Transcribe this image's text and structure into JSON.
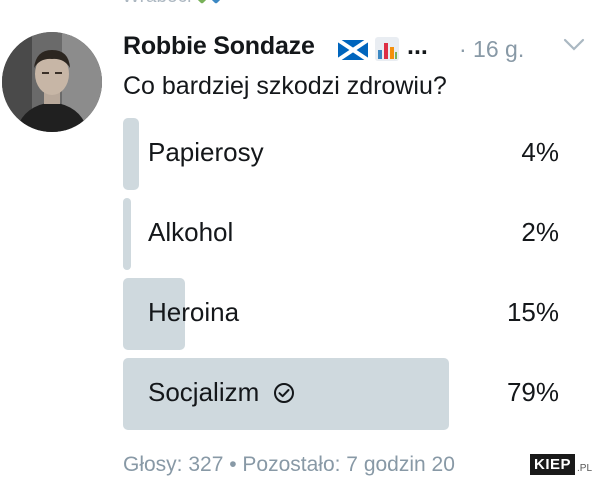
{
  "top_strip": {
    "text": "Wrabocr"
  },
  "tweet": {
    "author_name": "Robbie Sondaze",
    "ellipsis": "...",
    "timestamp": "· 16 g.",
    "question": "Co bardziej szkodzi zdrowiu?",
    "icons": {
      "flag": "scotland-flag-icon",
      "chart": "bar-chart-emoji-icon",
      "menu": "chevron-down-icon",
      "selected": "check-circle-icon"
    }
  },
  "poll": {
    "options": [
      {
        "label": "Papierosy",
        "percent_text": "4%",
        "fraction": 0.04,
        "selected": false
      },
      {
        "label": "Alkohol",
        "percent_text": "2%",
        "fraction": 0.02,
        "selected": false
      },
      {
        "label": "Heroina",
        "percent_text": "15%",
        "fraction": 0.15,
        "selected": false
      },
      {
        "label": "Socjalizm",
        "percent_text": "79%",
        "fraction": 0.79,
        "selected": true
      }
    ],
    "footer": "Głosy: 327 • Pozostało: 7 godzin 20"
  },
  "watermark": {
    "brand": "KIEP",
    "suffix": ".PL"
  },
  "colors": {
    "bar": "#cfd9de",
    "text": "#14171a",
    "muted": "#8899a6",
    "flag_blue": "#0065bd"
  }
}
